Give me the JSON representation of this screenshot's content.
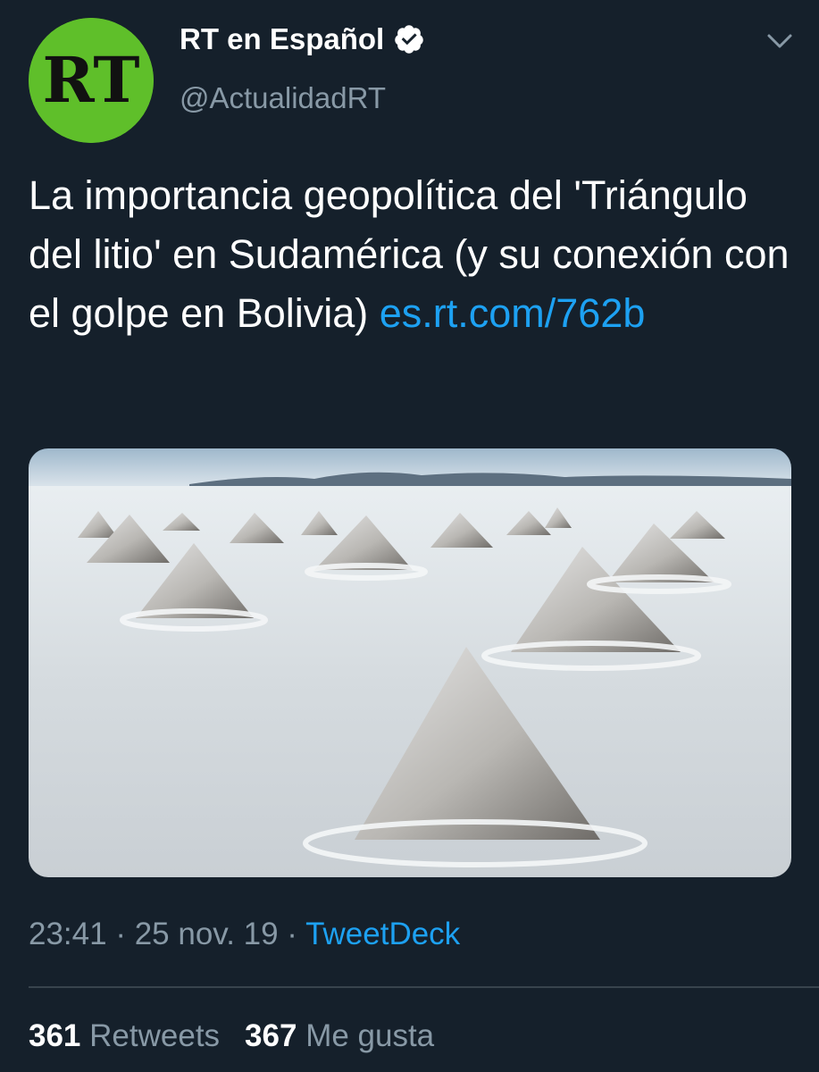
{
  "tweet": {
    "author": {
      "name": "RT en Español",
      "handle": "@ActualidadRT",
      "avatar_icon": "rt-logo-icon",
      "avatar_text": "RT",
      "avatar_color": "#5fbf2a",
      "verified_icon": "verified-badge-icon"
    },
    "menu_icon": "chevron-down-icon",
    "text": "La importancia geopolítica del 'Triángulo del litio' en Sudamérica (y su conexión con el golpe en Bolivia) ",
    "link_text": "es.rt.com/762b",
    "media": {
      "type": "photo",
      "subject": "salt-flat-pyramids"
    },
    "time": "23:41",
    "separator": " · ",
    "date": "25 nov. 19",
    "source": "TweetDeck",
    "stats": {
      "retweets_count": "361",
      "retweets_label": "Retweets",
      "likes_count": "367",
      "likes_label": "Me gusta"
    }
  },
  "colors": {
    "background": "#15202b",
    "accent": "#1da1f2",
    "secondary_text": "#8899a6",
    "divider": "#38444d"
  }
}
